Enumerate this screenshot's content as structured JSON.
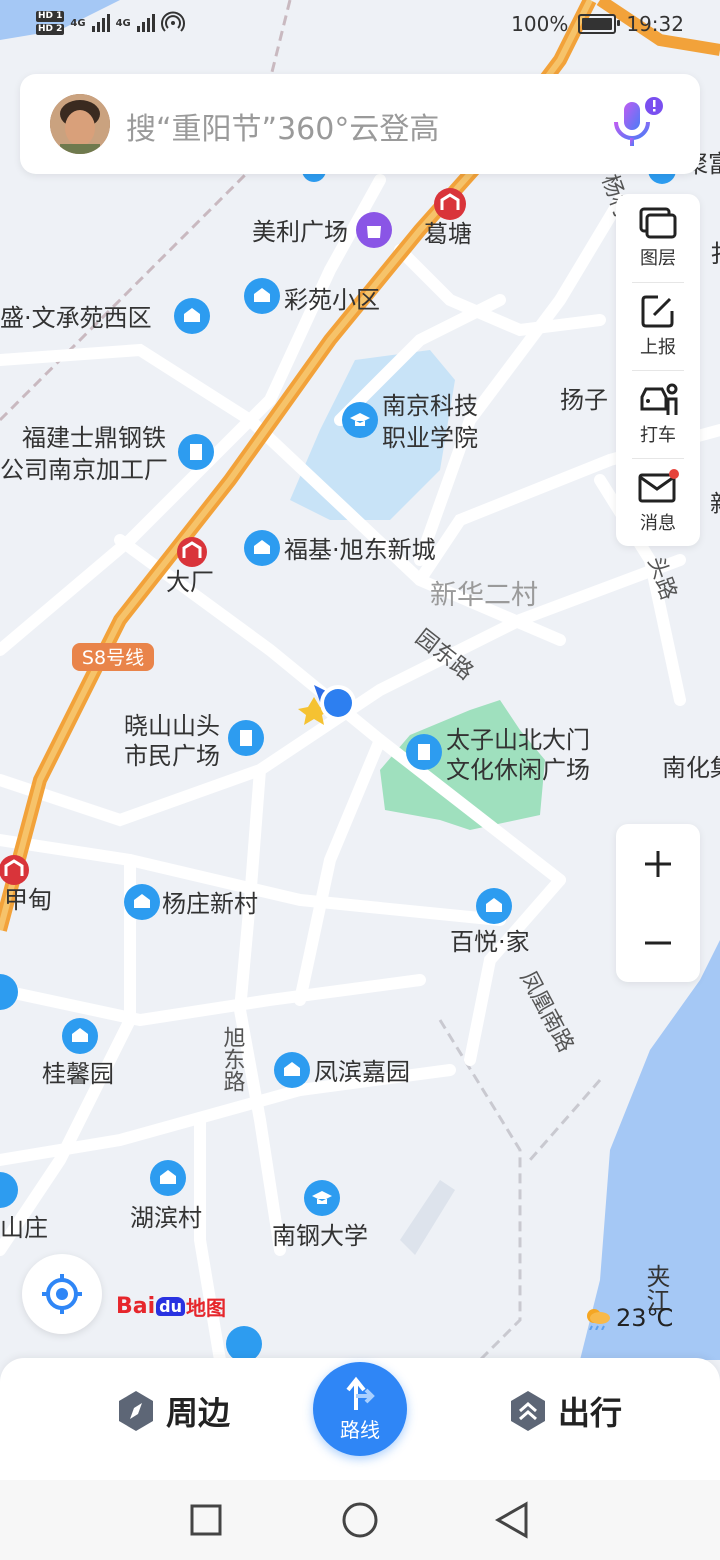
{
  "status_bar": {
    "hd1": "HD 1",
    "hd2": "HD 2",
    "net1": "4G",
    "net2": "4G",
    "battery": "100%",
    "time": "19:32"
  },
  "search": {
    "placeholder": "搜“重阳节”360°云登高"
  },
  "toolbar": {
    "layers": "图层",
    "report": "上报",
    "taxi": "打车",
    "messages": "消息"
  },
  "map_labels": {
    "meili": "美利广场",
    "getang": "葛塘",
    "caiyuan": "彩苑小区",
    "wenchengyuan": "盛·文承苑西区",
    "fujian_1": "福建士鼎钢铁",
    "fujian_2": "公司南京加工厂",
    "nanjing_keji_1": "南京科技",
    "nanjing_keji_2": "职业学院",
    "fuji": "福基·旭东新城",
    "dachang": "大厂",
    "xinhua": "新华二村",
    "s8": "S8号线",
    "yuandong_rd": "园东路",
    "xiaoshan_1": "晓山山头",
    "xiaoshan_2": "市民广场",
    "taizi_1": "太子山北大门",
    "taizi_2": "文化休闲广场",
    "nanhua": "南化集",
    "jiadian": "甲甸",
    "yangzhuang": "杨庄新村",
    "baiyue": "百悦·家",
    "fenghuang_rd": "凤凰南路",
    "xudong_rd": "旭东路",
    "guixin": "桂馨园",
    "fengbin": "凤滨嘉园",
    "hubin": "湖滨村",
    "nangang": "南钢大学",
    "shanzhuang": "山庄",
    "jiajiang": "夹江",
    "yangcun_rd": "杨村一路",
    "yangzi": "扬子",
    "wutou_rd": "头路",
    "right_cut": "扌",
    "right_cut2": "新",
    "top_cut": "聚富"
  },
  "weather": {
    "temp": "23℃"
  },
  "logo": {
    "text_bai": "Bai",
    "text_du": "du",
    "text_map": "地图"
  },
  "bottom_nav": {
    "nearby": "周边",
    "route": "路线",
    "travel": "出行"
  },
  "colors": {
    "accent": "#2f86f6",
    "poi_blue": "#2d9cf0",
    "highway": "#f2a23a",
    "water": "#a5c8f5",
    "park": "#9fe0be",
    "metro_red": "#d9343a"
  }
}
